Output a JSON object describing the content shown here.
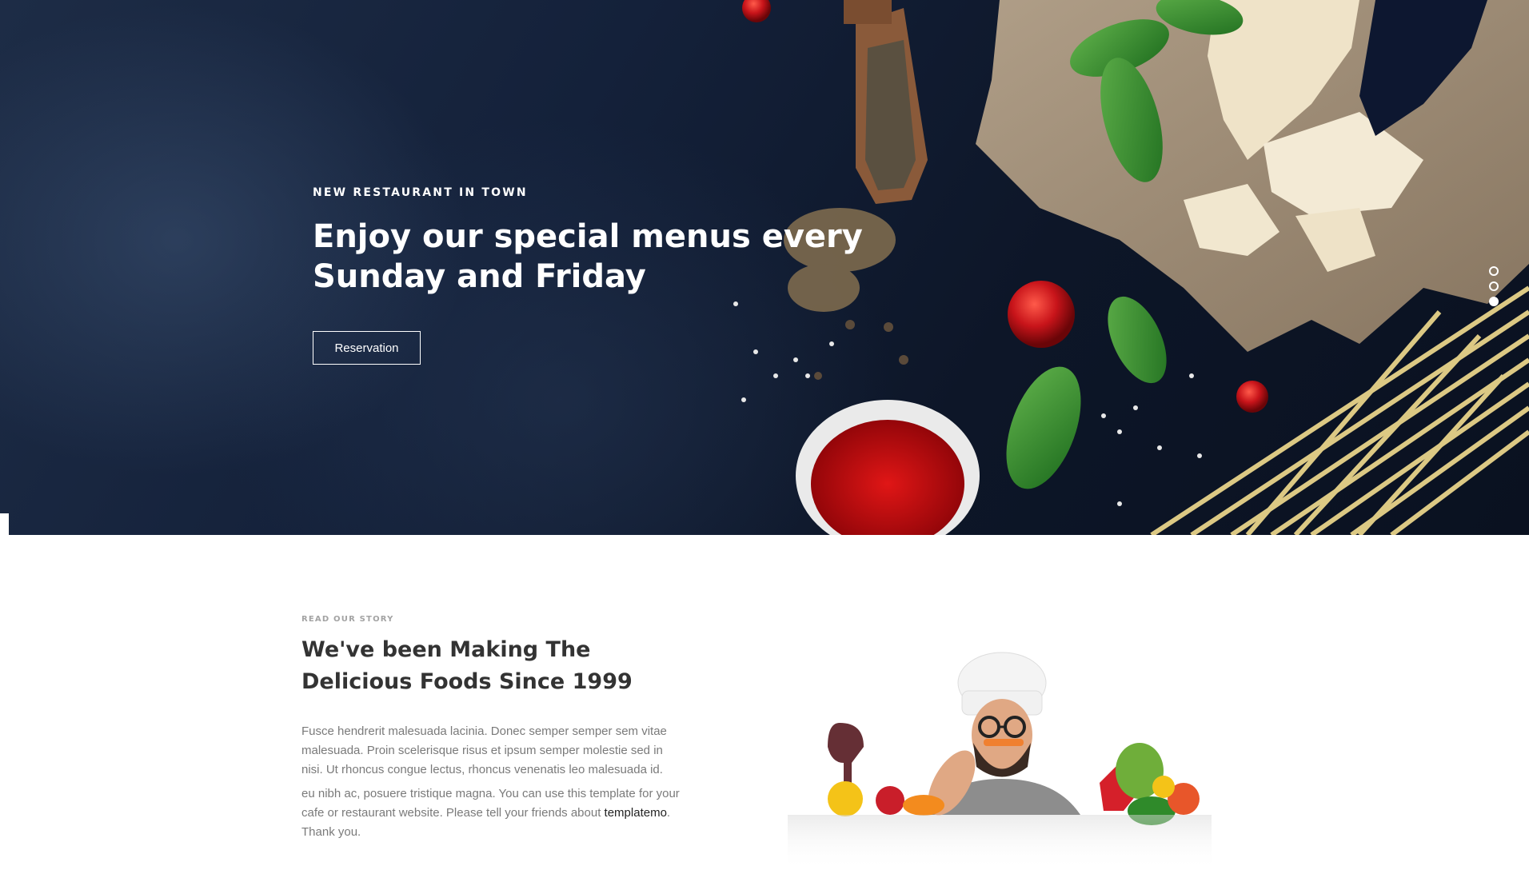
{
  "hero": {
    "eyebrow": "NEW RESTAURANT IN TOWN",
    "title": "Enjoy our special menus every Sunday and Friday",
    "button_label": "Reservation",
    "slides": 3,
    "active_slide": 3
  },
  "story": {
    "eyebrow": "READ OUR STORY",
    "title": "We've been Making The Delicious Foods Since 1999",
    "paragraph1": "Fusce hendrerit malesuada lacinia. Donec semper semper sem vitae malesuada. Proin scelerisque risus et ipsum semper molestie sed in nisi. Ut rhoncus congue lectus, rhoncus venenatis leo malesuada id.",
    "paragraph2_before": "eu nibh ac, posuere tristique magna. You can use this template for your cafe or restaurant website. Please tell your friends about ",
    "link_text": "templatemo",
    "paragraph2_after": ". Thank you."
  },
  "colors": {
    "hero_background": "#14213a",
    "heading_text": "#333333",
    "body_text": "#7a7a7a",
    "eyebrow_text": "#a3a3a3"
  },
  "icons": [
    "food-photo-illustration",
    "chef-photo-illustration",
    "slider-dot-icon"
  ]
}
